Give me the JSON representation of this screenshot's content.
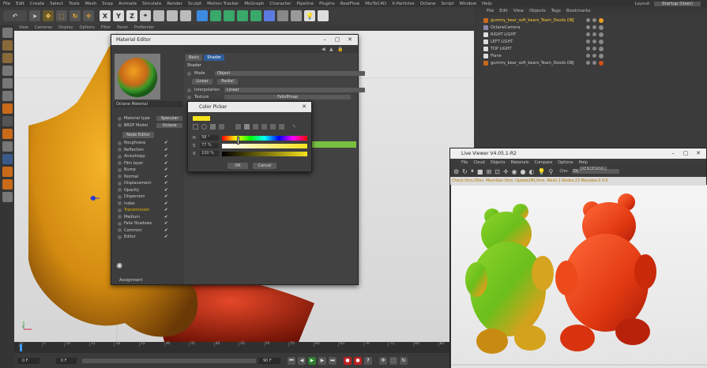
{
  "menubar": {
    "items": [
      "File",
      "Edit",
      "Create",
      "Select",
      "Tools",
      "Mesh",
      "Snap",
      "Animate",
      "Simulate",
      "Render",
      "Sculpt",
      "Motion Tracker",
      "MoGraph",
      "Character",
      "Pipeline",
      "Plugins",
      "RealFlow",
      "MixToC4D",
      "X-Particles",
      "Octane",
      "Script",
      "Window",
      "Help"
    ],
    "layout_label": "Layout:",
    "layout_value": "Startup (User)"
  },
  "viewport_menu": [
    "View",
    "Cameras",
    "Display",
    "Options",
    "Filter",
    "Panel",
    "ProRender"
  ],
  "object_manager": {
    "menu": [
      "File",
      "Edit",
      "View",
      "Objects",
      "Tags",
      "Bookmarks"
    ],
    "objects": [
      {
        "name": "gummy_bear_soft_bears_Team_Doods.OBJ",
        "selected": true
      },
      {
        "name": "OctaneCamera",
        "selected": false
      },
      {
        "name": "RIGHT LIGHT",
        "selected": false
      },
      {
        "name": "LEFT LIGHT",
        "selected": false
      },
      {
        "name": "TOP LIGHT",
        "selected": false
      },
      {
        "name": "Plane",
        "selected": false
      },
      {
        "name": "gummy_bear_soft_bears_Team_Doods.OBJ",
        "selected": false
      }
    ]
  },
  "material_editor": {
    "title": "Material Editor",
    "material_name": "Octane Material",
    "material_type_label": "Material type",
    "material_type_value": "Specular",
    "brdf_label": "BRDF Model",
    "brdf_value": "Octane",
    "node_editor_button": "Node Editor",
    "channels": [
      "Roughness",
      "Reflection",
      "Anisotropy",
      "Film layer",
      "Bump",
      "Normal",
      "Displacement",
      "Opacity",
      "Dispersion",
      "Index",
      "Transmission",
      "Medium",
      "Fake Shadows",
      "Common",
      "Editor"
    ],
    "active_channel": "Transmission",
    "tabs": [
      "Basic",
      "Shader"
    ],
    "active_tab": "Shader",
    "shader_label": "Shader",
    "mode_label": "Mode",
    "mode_value": "Object",
    "btn_linear": "Linear",
    "btn_radial": "Radial",
    "interpolation_label": "Interpolation",
    "interpolation_value": "Linear",
    "texture_label": "Texture",
    "texture_value": "Falloffmap",
    "assignment_label": "Assignment"
  },
  "color_picker": {
    "title": "Color Picker",
    "h_label": "H",
    "h_value": "58 °",
    "s_label": "S",
    "s_value": "77 %",
    "v_label": "V",
    "v_value": "100 %",
    "ok": "OK",
    "cancel": "Cancel",
    "swatch_color": "#f4e21c"
  },
  "live_viewer": {
    "title": "Live Viewer V4.05.1-R2",
    "menu": [
      "File",
      "Cloud",
      "Objects",
      "Materials",
      "Compare",
      "Options",
      "Help"
    ],
    "render_mode": "[RENDERING]",
    "chn_label": "Chn:",
    "chn_value": "DL",
    "status": "Check:0ms./0ms. MeshGen:0ms. Update[M]:0ms. Mesh:1 Nodes:23 Movable:0 0:0"
  },
  "timeline": {
    "start": "0 F",
    "end": "90 F",
    "ticks": [
      "0",
      "5",
      "10",
      "15",
      "20",
      "25",
      "30",
      "35",
      "40",
      "45",
      "50",
      "55",
      "60",
      "65",
      "70",
      "75",
      "80",
      "85",
      "90"
    ],
    "current": "0 F"
  },
  "colors": {
    "accent": "#f0b400",
    "gummy_green": "#6bbf1c",
    "gummy_red": "#e23a12",
    "gummy_orange": "#f2a818"
  }
}
